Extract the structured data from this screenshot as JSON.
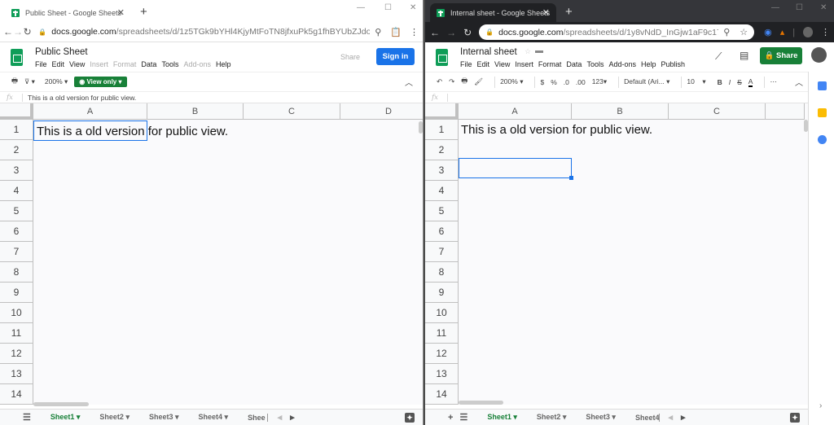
{
  "left_window": {
    "tab_title": "Public Sheet - Google Sheets",
    "url_host": "docs.google.com",
    "url_path": "/spreadsheets/d/1z5TGk9bYHl4KjyMtFoTN8jfxuPk5g1fhBYUbZJdoFn...",
    "doc_title": "Public Sheet",
    "menu": [
      "File",
      "Edit",
      "View",
      "Insert",
      "Format",
      "Data",
      "Tools",
      "Add-ons",
      "Help"
    ],
    "menu_disabled": [
      "Insert",
      "Format",
      "Add-ons"
    ],
    "share_label": "Share",
    "signin_label": "Sign in",
    "zoom": "200%",
    "view_only_label": "View only",
    "formula_value": "This is a old version for public view.",
    "columns": [
      "A",
      "B",
      "C",
      "D"
    ],
    "rows": [
      "1",
      "2",
      "3",
      "4",
      "5",
      "6",
      "7",
      "8",
      "9",
      "10",
      "11",
      "12",
      "13",
      "14"
    ],
    "cell_A1": "This is a old version for public view.",
    "selected_cell": "A1",
    "sheet_tabs": [
      "Sheet1",
      "Sheet2",
      "Sheet3",
      "Sheet4",
      "Shee"
    ],
    "active_sheet": "Sheet1"
  },
  "right_window": {
    "tab_title": "Internal sheet - Google Sheets",
    "url_host": "docs.google.com",
    "url_path": "/spreadsheets/d/1y8vNdD_InGjw1aF9c17Nstw...",
    "doc_title": "Internal sheet",
    "menu": [
      "File",
      "Edit",
      "View",
      "Insert",
      "Format",
      "Data",
      "Tools",
      "Add-ons",
      "Help",
      "Publish"
    ],
    "share_label": "Share",
    "toolbar": {
      "zoom": "200%",
      "currency": "$",
      "percent": "%",
      "dec_decrease": ".0",
      "dec_increase": ".00",
      "more_formats": "123",
      "font": "Default (Ari...",
      "font_size": "10",
      "bold": "B",
      "italic": "I",
      "strike": "S",
      "text_color": "A",
      "more": "⋯"
    },
    "formula_value": "",
    "columns": [
      "A",
      "B",
      "C"
    ],
    "rows": [
      "1",
      "2",
      "3",
      "4",
      "5",
      "6",
      "7",
      "8",
      "9",
      "10",
      "11",
      "12",
      "13",
      "14"
    ],
    "cell_A1": "This is a old version for public view.",
    "selected_cell": "A3",
    "sheet_tabs": [
      "Sheet1",
      "Sheet2",
      "Sheet3",
      "Sheet4"
    ],
    "active_sheet": "Sheet1"
  },
  "colors": {
    "sheets_green": "#0f9d58",
    "share_green": "#188038",
    "signin_blue": "#1a73e8",
    "selection_blue": "#1a73e8"
  }
}
